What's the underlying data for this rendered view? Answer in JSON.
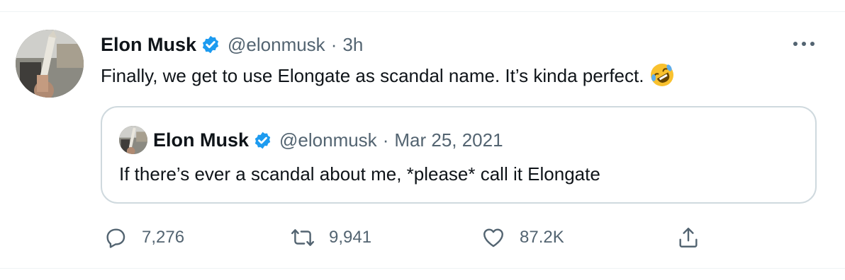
{
  "tweet": {
    "author_name": "Elon Musk",
    "handle": "@elonmusk",
    "separator": "·",
    "time": "3h",
    "text": "Finally, we get to use Elongate as scandal name. It’s kinda perfect.",
    "emoji": "rolling-on-floor-laughing-emoji",
    "more_icon": "more-horizontal-icon"
  },
  "quoted_tweet": {
    "author_name": "Elon Musk",
    "handle": "@elonmusk",
    "separator": "·",
    "date": "Mar 25, 2021",
    "text": "If there’s ever a scandal about me, *please* call it Elongate"
  },
  "actions": {
    "replies": "7,276",
    "retweets": "9,941",
    "likes": "87.2K",
    "reply_icon": "reply-icon",
    "retweet_icon": "retweet-icon",
    "like_icon": "heart-icon",
    "share_icon": "share-icon"
  },
  "colors": {
    "text": "#0f1419",
    "secondary": "#536471",
    "verified": "#1d9bf0",
    "border": "#cfd9de"
  }
}
